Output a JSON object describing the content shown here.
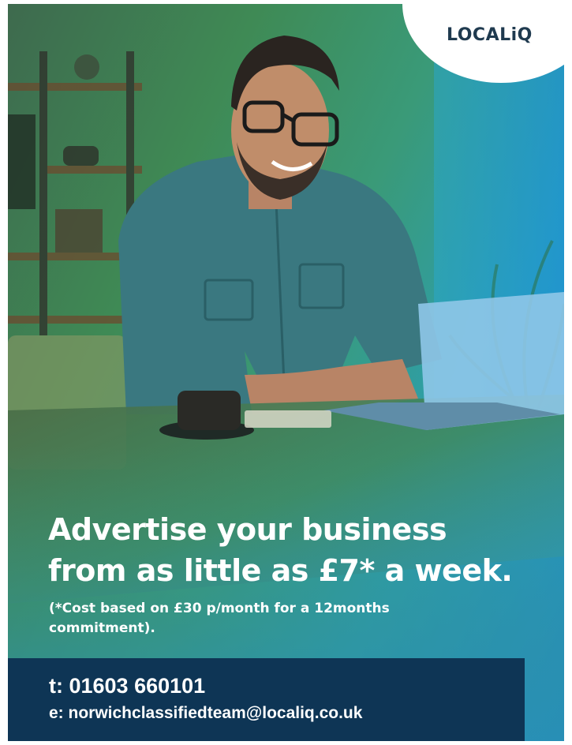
{
  "brand": {
    "logo_text": "LOCALiQ",
    "accent": "#0e3555",
    "badge_color": "#ffffff"
  },
  "headline": {
    "line1": "Advertise your business",
    "line2": "from as little as £7* a week."
  },
  "footnote": "(*Cost based on £30 p/month for a 12months commitment).",
  "contact": {
    "phone": "t: 01603 660101",
    "email": "e: norwichclassifiedteam@localiq.co.uk"
  },
  "photo": {
    "subject": "smiling man with glasses using a laptop at a wooden table"
  }
}
